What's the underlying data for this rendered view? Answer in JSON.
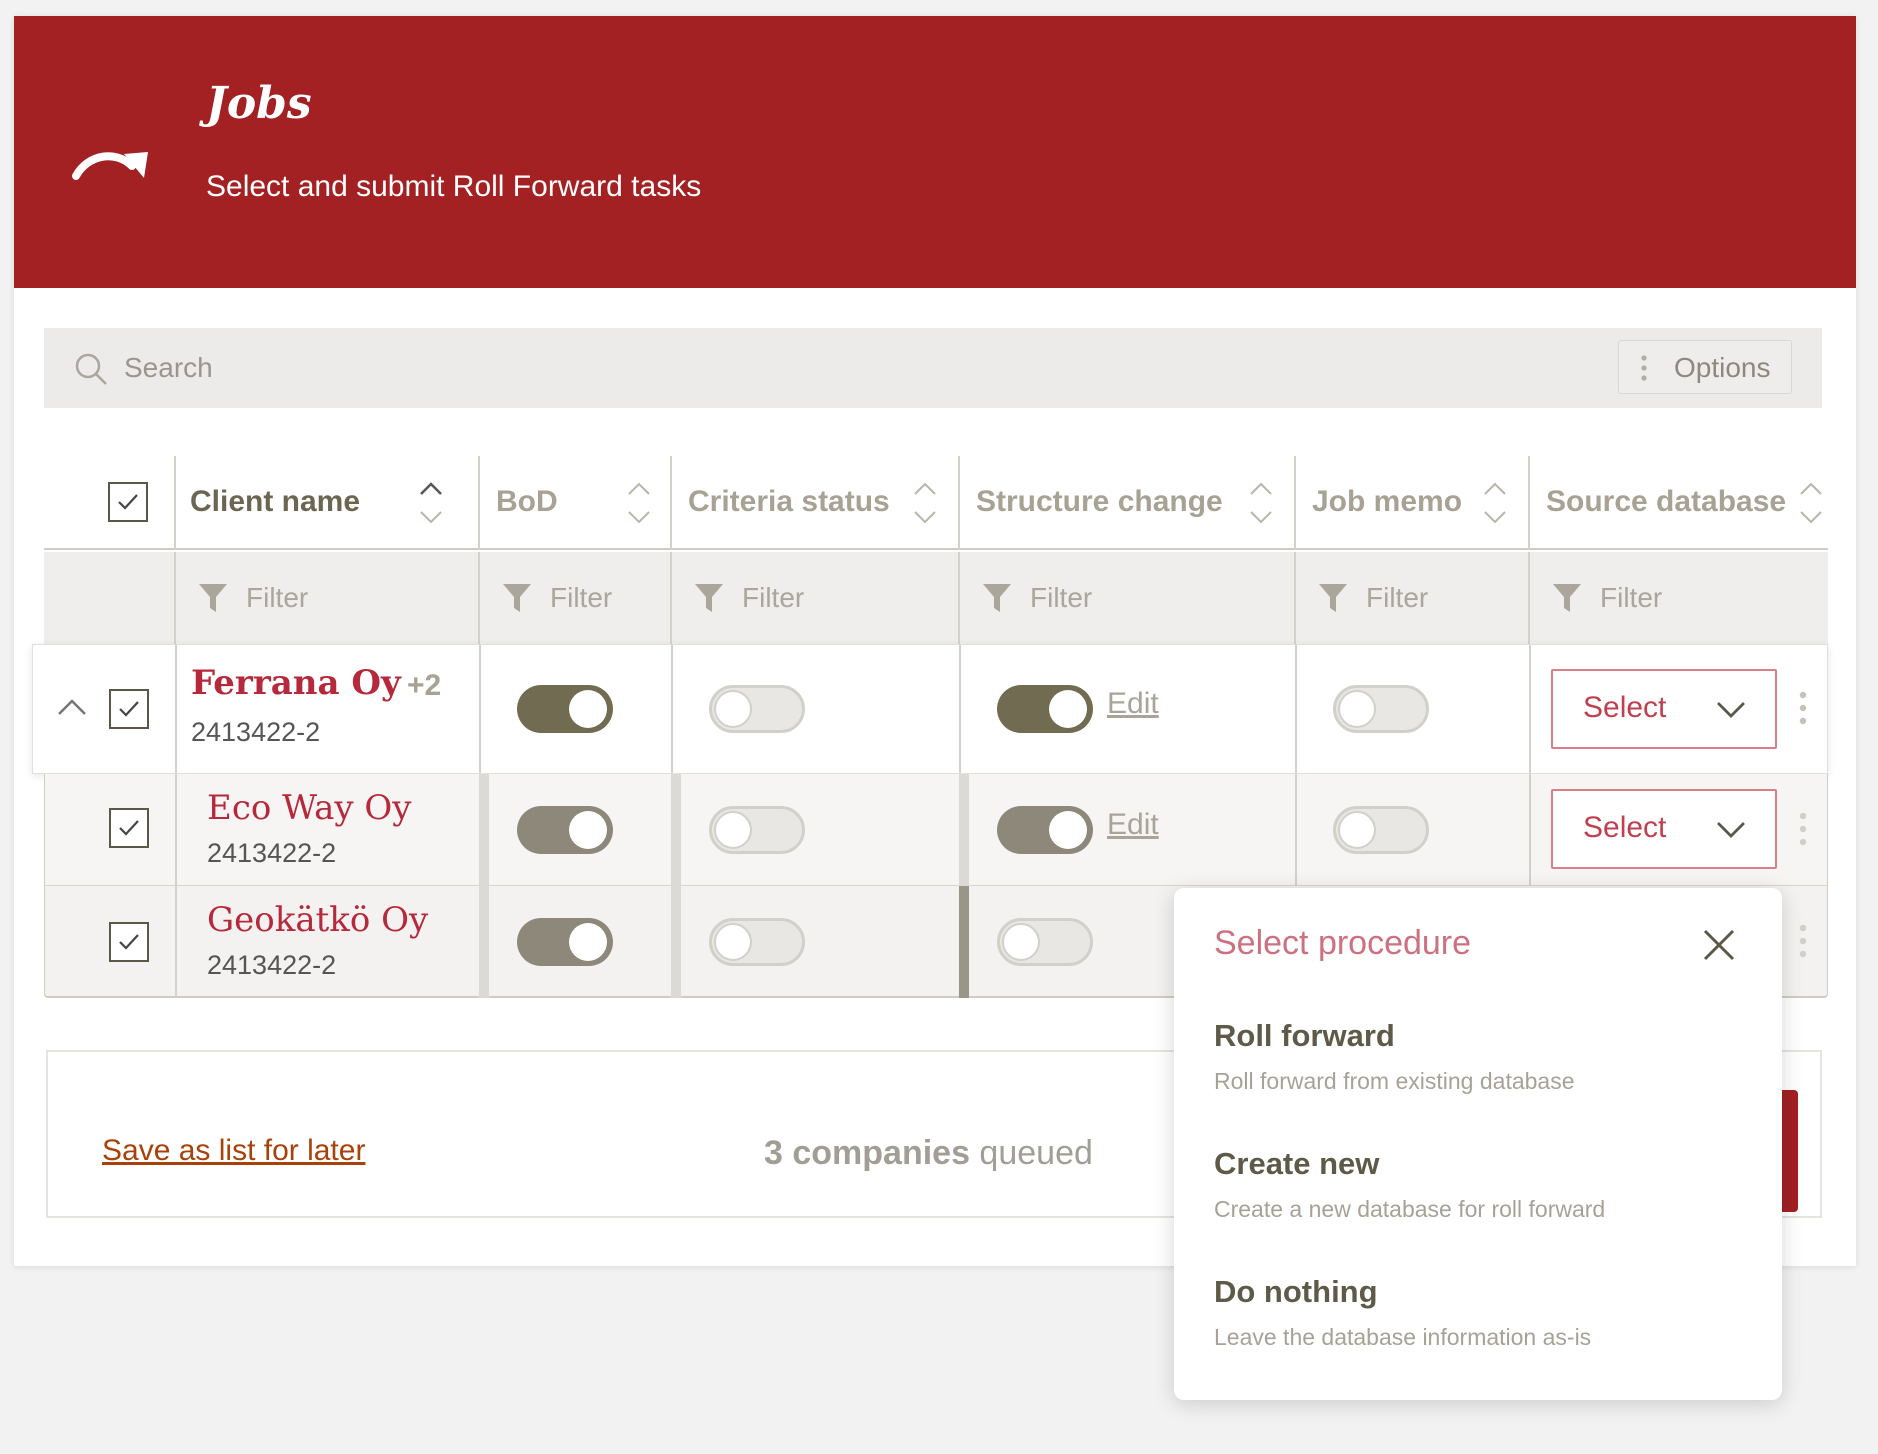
{
  "header": {
    "title": "Jobs",
    "subtitle": "Select and submit Roll Forward tasks",
    "logo_icon": "roll-forward-arrow-icon"
  },
  "search": {
    "placeholder": "Search",
    "options_label": "Options"
  },
  "table": {
    "columns": [
      {
        "key": "client_name",
        "label": "Client name"
      },
      {
        "key": "bod",
        "label": "BoD"
      },
      {
        "key": "criteria_status",
        "label": "Criteria status"
      },
      {
        "key": "structure_change",
        "label": "Structure change"
      },
      {
        "key": "job_memo",
        "label": "Job memo"
      },
      {
        "key": "source_database",
        "label": "Source database"
      }
    ],
    "filter_placeholder": "Filter",
    "rows": [
      {
        "name": "Ferrana Oy",
        "extra": "+2",
        "id": "2413422-2",
        "checked": true,
        "expanded": true,
        "bod": true,
        "criteria_status": false,
        "structure_change": true,
        "structure_edit": "Edit",
        "job_memo": false,
        "source_database": "Select"
      },
      {
        "name": "Eco Way Oy",
        "id": "2413422-2",
        "checked": true,
        "bod": true,
        "criteria_status": false,
        "structure_change": true,
        "structure_edit": "Edit",
        "job_memo": false,
        "source_database": "Select"
      },
      {
        "name": "Geokätkö Oy",
        "id": "2413422-2",
        "checked": true,
        "bod": true,
        "criteria_status": false,
        "structure_change": false
      }
    ]
  },
  "footer": {
    "save_link": "Save as list for later",
    "queued_count": "3 companies",
    "queued_suffix": " queued"
  },
  "popup": {
    "title": "Select procedure",
    "options": [
      {
        "title": "Roll forward",
        "description": "Roll forward from existing database"
      },
      {
        "title": "Create new",
        "description": "Create a new database for roll forward"
      },
      {
        "title": "Do nothing",
        "description": "Leave the database information as-is"
      }
    ]
  },
  "colors": {
    "brand": "#a32023",
    "accent_text": "#b6283b",
    "toggle_on": "#716b52",
    "link": "#a8420a"
  }
}
